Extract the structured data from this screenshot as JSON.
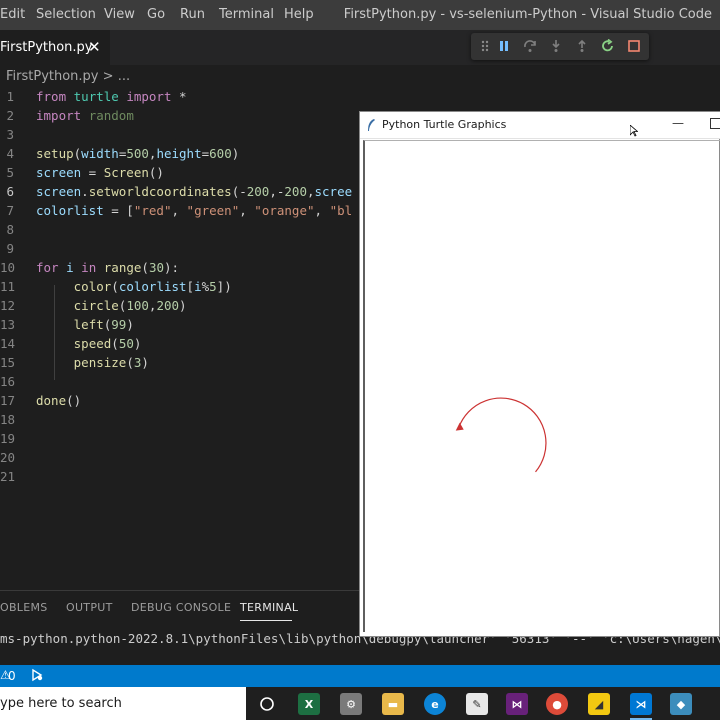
{
  "menubar": {
    "items": [
      "Edit",
      "Selection",
      "View",
      "Go",
      "Run",
      "Terminal",
      "Help"
    ],
    "window_title": "FirstPython.py - vs-selenium-Python - Visual Studio Code"
  },
  "tab": {
    "label": "FirstPython.py",
    "close": "✕"
  },
  "breadcrumb": {
    "file": "FirstPython.py",
    "sep": ">",
    "more": "..."
  },
  "editor": {
    "line_numbers": [
      "1",
      "2",
      "3",
      "4",
      "5",
      "6",
      "7",
      "8",
      "9",
      "10",
      "11",
      "12",
      "13",
      "14",
      "15",
      "16",
      "17",
      "18",
      "19",
      "20",
      "21"
    ],
    "active_line": "6",
    "lines": [
      "from turtle import *",
      "import random",
      "",
      "setup(width=500,height=600)",
      "screen = Screen()",
      "screen.setworldcoordinates(-200,-200,scree",
      "colorlist = [\"red\", \"green\", \"orange\", \"bl",
      "",
      "",
      "for i in range(30):",
      "     color(colorlist[i%5])",
      "     circle(100,200)",
      "     left(99)",
      "     speed(50)",
      "     pensize(3)",
      "",
      "done()",
      "",
      "",
      "",
      ""
    ]
  },
  "debug_toolbar": {
    "icons": [
      "drag-handle-icon",
      "pause-icon",
      "step-over-icon",
      "step-into-icon",
      "step-out-icon",
      "restart-icon",
      "stop-icon"
    ]
  },
  "panel": {
    "tabs": [
      "OBLEMS",
      "OUTPUT",
      "DEBUG CONSOLE",
      "TERMINAL"
    ],
    "active_tab": "TERMINAL",
    "terminal_line": "ms-python.python-2022.8.1\\pythonFiles\\lib\\python\\debugpy\\launcher' '56313' '--' 'c:\\Users\\nagen\\De"
  },
  "statusbar": {
    "count": "0"
  },
  "taskbar": {
    "search_placeholder": "ype here to search"
  },
  "turtle_window": {
    "title": "Python Turtle Graphics",
    "pen_color": "#cc3333",
    "arc_degrees": 200
  },
  "colors": {
    "accent": "#007acc",
    "editor_bg": "#1e1e1e",
    "menubar_bg": "#3c3c3c"
  }
}
